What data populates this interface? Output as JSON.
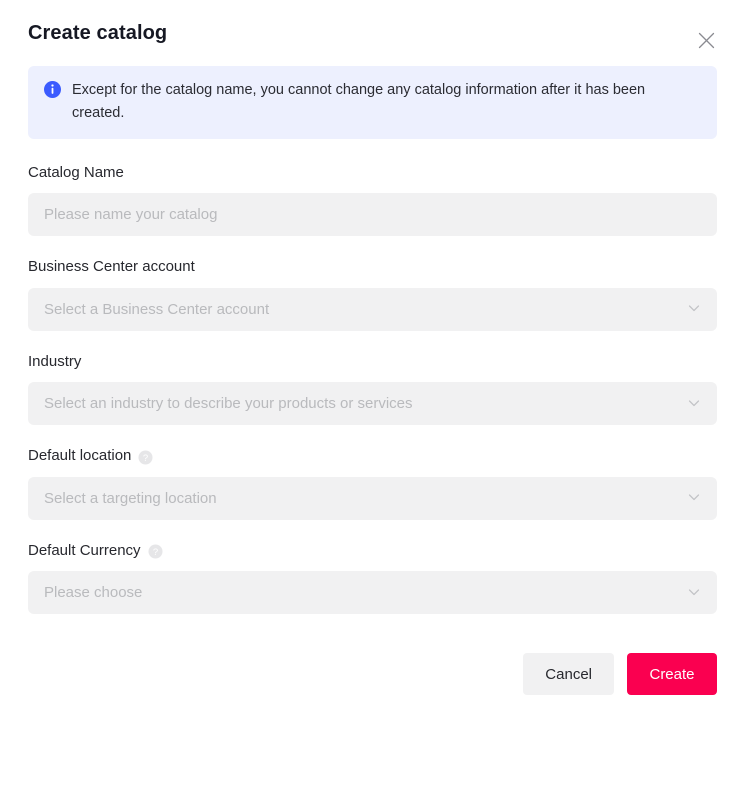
{
  "dialog": {
    "title": "Create catalog",
    "close_icon": "close-icon"
  },
  "banner": {
    "icon": "info-circle-icon",
    "text": "Except for the catalog name, you cannot change any catalog information after it has been created.",
    "background_color": "#EDF0FE",
    "icon_color": "#3B5BFE"
  },
  "fields": {
    "catalog_name": {
      "label": "Catalog Name",
      "placeholder": "Please name your catalog",
      "value": ""
    },
    "business_center_account": {
      "label": "Business Center account",
      "placeholder": "Select a Business Center account",
      "value": "",
      "chevron_icon": "chevron-down-icon"
    },
    "industry": {
      "label": "Industry",
      "placeholder": "Select an industry to describe your products or services",
      "value": "",
      "chevron_icon": "chevron-down-icon"
    },
    "default_location": {
      "label": "Default location",
      "help_icon": "help-circle-icon",
      "placeholder": "Select a targeting location",
      "value": "",
      "chevron_icon": "chevron-down-icon"
    },
    "default_currency": {
      "label": "Default Currency",
      "help_icon": "help-circle-icon",
      "placeholder": "Please choose",
      "value": "",
      "chevron_icon": "chevron-down-icon"
    }
  },
  "footer": {
    "cancel_label": "Cancel",
    "create_label": "Create",
    "create_color": "#FA0050"
  }
}
